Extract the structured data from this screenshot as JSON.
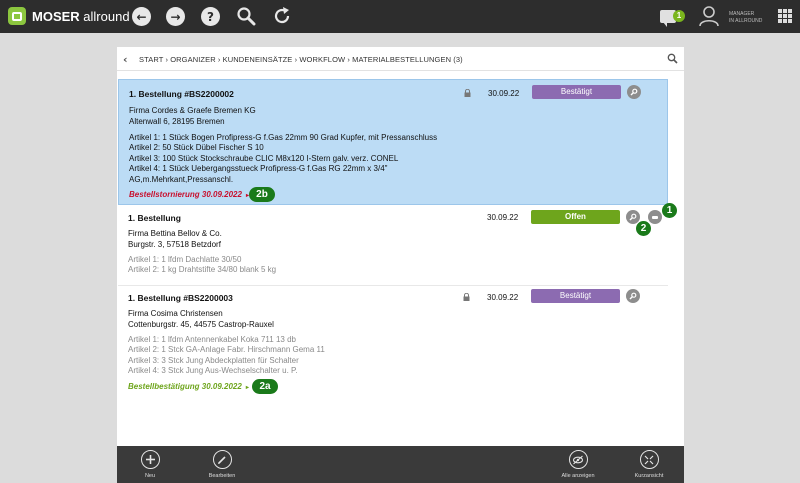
{
  "app": {
    "brand": "MOSER",
    "name": "allround"
  },
  "topbar": {
    "back_glyph": "←",
    "forward_glyph": "→",
    "help_glyph": "?",
    "notification_count": "1",
    "user_line1": "MANAGER",
    "user_line2": "IN ALLROUND"
  },
  "breadcrumb": {
    "text": "START › ORGANIZER › KUNDENEINSÄTZE › WORKFLOW › MATERIALBESTELLUNGEN  (3)"
  },
  "orders": [
    {
      "title": "1. Bestellung #BS2200002",
      "date": "30.09.22",
      "status": "Bestätigt",
      "company": "Firma Cordes & Graefe Bremen KG",
      "address": "Altenwall 6, 28195 Bremen",
      "articles": [
        "Artikel 1: 1 Stück Bogen Profipress-G  f.Gas 22mm 90 Grad Kupfer, mit Pressanschluss",
        "Artikel 2: 50 Stück Dübel Fischer S 10",
        "Artikel 3: 100 Stück Stockschraube CLIC M8x120 I-Stern galv. verz. CONEL",
        "Artikel 4: 1 Stück Uebergangsstueck Profipress-G  f.Gas  RG 22mm x   3/4\"",
        "AG,m.Mehrkant,Pressanschl."
      ],
      "link": "Bestellstornierung 30.09.2022",
      "annotation": "2b"
    },
    {
      "title": "1. Bestellung",
      "date": "30.09.22",
      "status": "Offen",
      "company": "Firma Bettina Bellov & Co.",
      "address": "Burgstr. 3, 57518 Betzdorf",
      "articles": [
        "Artikel 1: 1 lfdm Dachlatte 30/50",
        "Artikel 2: 1 kg Drahtstifte 34/80 blank 5 kg"
      ],
      "annotation_1": "1",
      "annotation_2": "2"
    },
    {
      "title": "1. Bestellung #BS2200003",
      "date": "30.09.22",
      "status": "Bestätigt",
      "company": "Firma Cosima Christensen",
      "address": "Cottenburgstr. 45, 44575 Castrop-Rauxel",
      "articles": [
        "Artikel 1: 1 lfdm Antennenkabel Koka 711 13 db",
        "Artikel 2: 1 Stck GA-Anlage Fabr. Hirschmann Gema 11",
        "Artikel 3: 3 Stck Jung Abdeckplatten für Schalter",
        "Artikel 4: 3 Stck Jung Aus-Wechselschalter u. P."
      ],
      "link": "Bestellbestätigung 30.09.2022",
      "annotation": "2a"
    }
  ],
  "toolbar": {
    "new_label": "Neu",
    "edit_label": "Bearbeiten",
    "show_all_label": "Alle anzeigen",
    "compact_label": "Kurzansicht"
  },
  "colors": {
    "topbar": "#2d2d2d",
    "brand_green": "#8cc63f",
    "status_confirmed": "#8c6bb1",
    "status_open": "#6ea51c",
    "storno_red": "#c8102e",
    "confirm_green": "#6ea51c",
    "selected_row": "#bcdcf5",
    "annotation_green": "#1a7a1a"
  },
  "icons": {
    "back": "back-arrow-icon",
    "forward": "forward-arrow-icon",
    "help": "help-icon",
    "search": "search-icon",
    "refresh": "refresh-icon",
    "chat": "chat-icon",
    "user": "user-icon",
    "apps": "apps-grid-icon",
    "lock": "lock-icon"
  }
}
